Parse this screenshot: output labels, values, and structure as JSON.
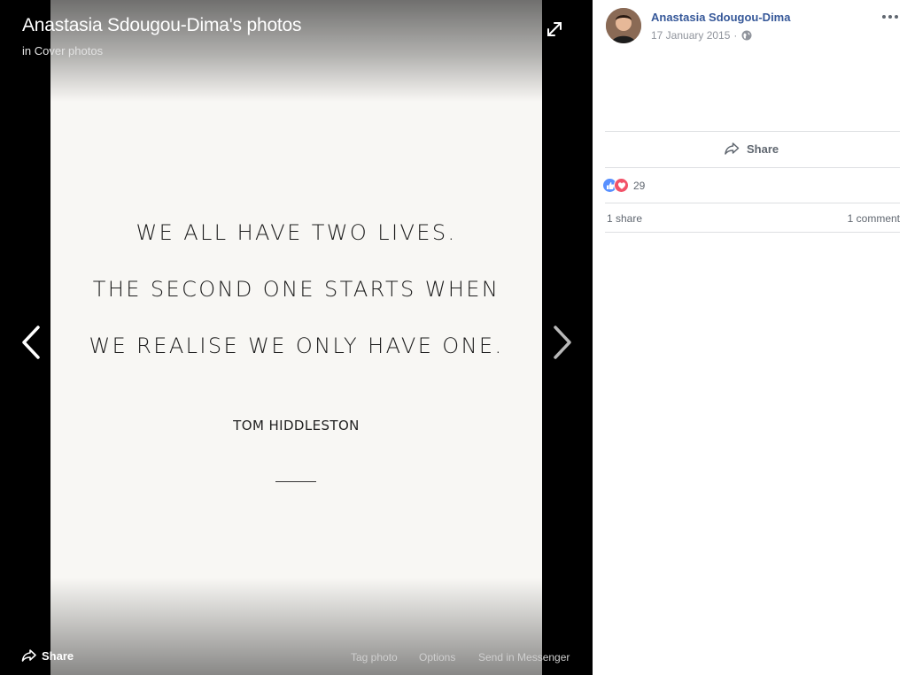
{
  "viewer": {
    "title": "Anastasia Sdougou-Dima's photos",
    "subtitle_prefix": "in",
    "album": "Cover photos",
    "photo": {
      "lines": [
        "WE ALL HAVE TWO LIVES.",
        "THE SECOND ONE STARTS WHEN",
        "WE REALISE WE ONLY HAVE ONE."
      ],
      "author": "TOM HIDDLESTON"
    },
    "actions": {
      "share": "Share",
      "tag_photo": "Tag photo",
      "options": "Options",
      "send_messenger": "Send in Messenger"
    }
  },
  "panel": {
    "author_name": "Anastasia Sdougou-Dima",
    "date": "17 January 2015",
    "date_separator": "·",
    "share_label": "Share",
    "reaction_count": "29",
    "shares": "1 share",
    "comments": "1 comment"
  },
  "colors": {
    "link_blue": "#365899",
    "meta_gray": "#90949c",
    "like_blue": "#5890ff",
    "love_red": "#f25268",
    "divider": "#dddfe2"
  }
}
